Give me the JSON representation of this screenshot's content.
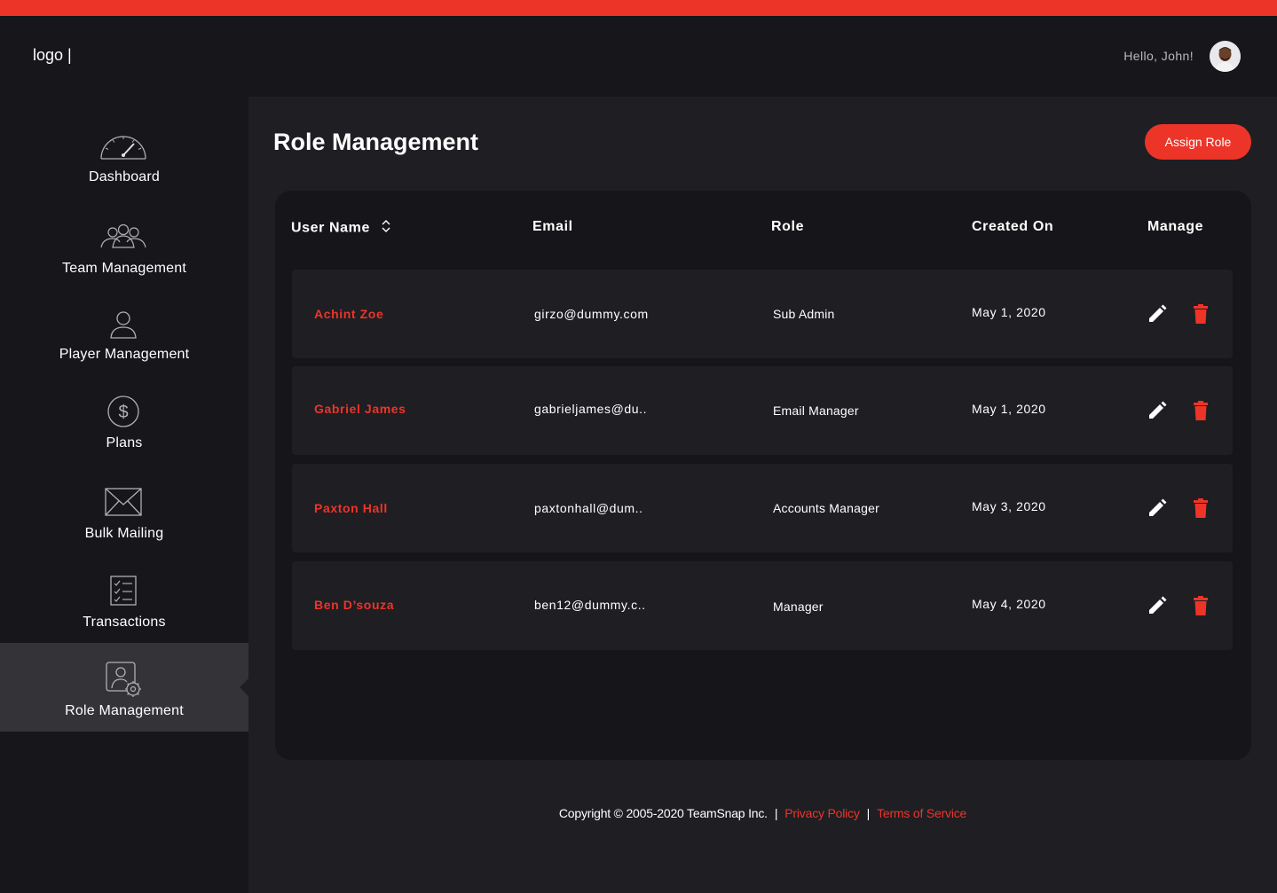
{
  "header": {
    "logo": "logo |",
    "greeting": "Hello, John!"
  },
  "sidebar": {
    "items": [
      {
        "label": "Dashboard",
        "icon": "speedometer-icon"
      },
      {
        "label": "Team Management",
        "icon": "team-icon"
      },
      {
        "label": "Player Management",
        "icon": "user-icon"
      },
      {
        "label": "Plans",
        "icon": "dollar-icon"
      },
      {
        "label": "Bulk Mailing",
        "icon": "envelope-icon"
      },
      {
        "label": "Transactions",
        "icon": "checklist-icon"
      },
      {
        "label": "Role Management",
        "icon": "user-settings-icon",
        "active": true
      }
    ]
  },
  "main": {
    "title": "Role Management",
    "assign_label": "Assign Role",
    "columns": [
      "User Name",
      "Email",
      "Role",
      "Created On",
      "Manage"
    ],
    "rows": [
      {
        "name": "Achint Zoe",
        "email": "girzo@dummy.com",
        "role": "Sub Admin",
        "created": "May 1, 2020"
      },
      {
        "name": "Gabriel James",
        "email": "gabrieljames@du..",
        "role": "Email Manager",
        "created": "May 1, 2020"
      },
      {
        "name": "Paxton Hall",
        "email": "paxtonhall@dum..",
        "role": "Accounts Manager",
        "created": "May 3, 2020"
      },
      {
        "name": "Ben D’souza",
        "email": "ben12@dummy.c..",
        "role": "Manager",
        "created": "May 4, 2020"
      }
    ]
  },
  "footer": {
    "copyright": "Copyright © 2005-2020 TeamSnap Inc.",
    "sep1": "|",
    "privacy": "Privacy Policy",
    "sep2": "|",
    "terms": "Terms of Service"
  },
  "colors": {
    "accent": "#ec3528",
    "background": "#17161b",
    "panel": "#1f1e23"
  }
}
